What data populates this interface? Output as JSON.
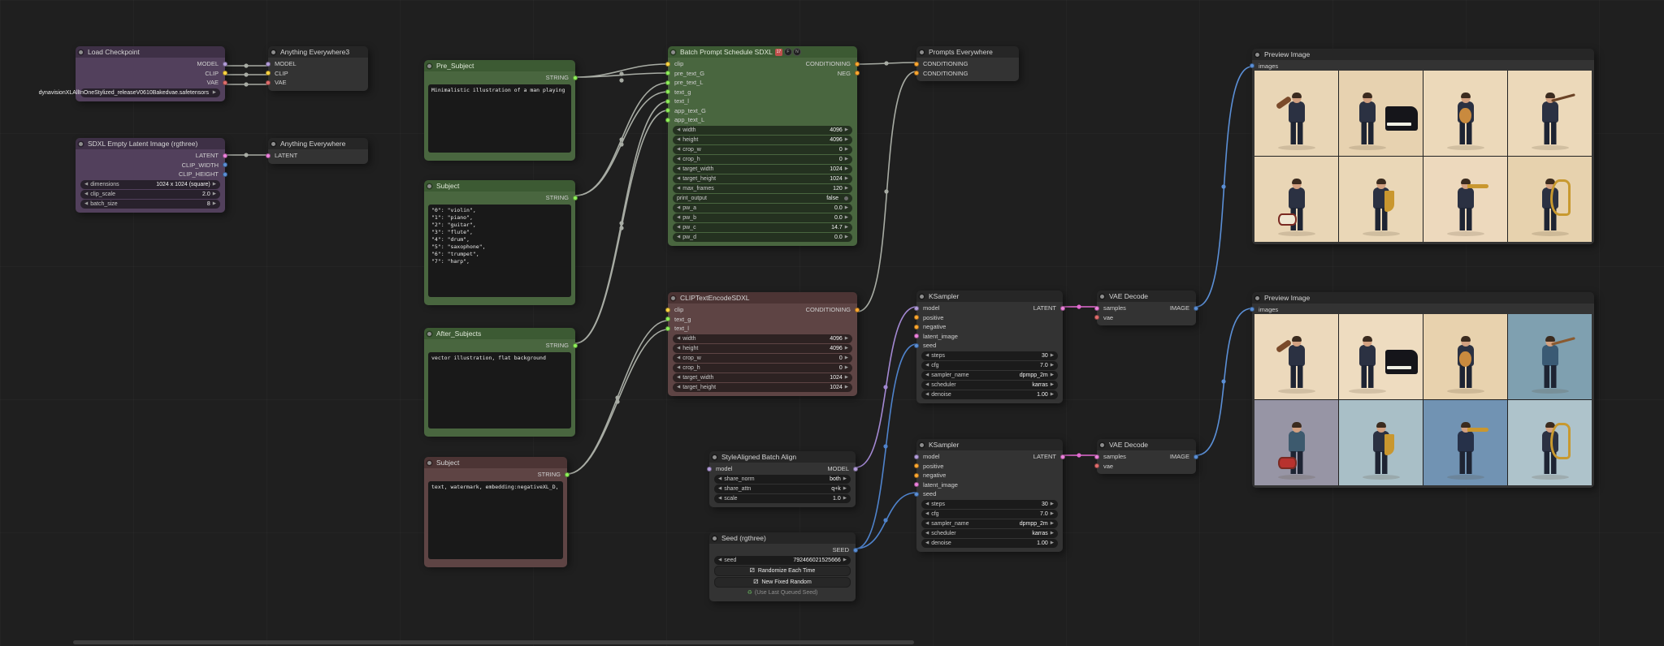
{
  "colors": {
    "model": "#b39ddb",
    "clip": "#ffd642",
    "vae": "#e06d6d",
    "latent": "#ee82dd",
    "conditioning": "#ffa931",
    "image": "#5b8fd6",
    "string": "#8ff05a",
    "int": "#5b8fd6",
    "seed": "#5b8fd6",
    "wire_gray": "#a8aca4",
    "wire_model": "#a489d4",
    "wire_latent": "#e26ad0",
    "wire_image": "#5b8fd6",
    "wire_seed": "#4f83cc"
  },
  "icons": {
    "dice": "⚂",
    "recycle": "♻"
  },
  "nodes": {
    "load_checkpoint": {
      "title": "Load Checkpoint",
      "outputs": [
        "MODEL",
        "CLIP",
        "VAE"
      ],
      "ckpt_name": "dynavisionXLAllInOneStylized_releaseV0610Bakedvae.safetensors"
    },
    "anything_everywhere3": {
      "title": "Anything Everywhere3",
      "inputs": [
        "MODEL",
        "CLIP",
        "VAE"
      ]
    },
    "sdxl_latent": {
      "title": "SDXL Empty Latent Image (rgthree)",
      "outputs": [
        "LATENT",
        "CLIP_WIDTH",
        "CLIP_HEIGHT"
      ],
      "widgets": [
        {
          "l": "dimensions",
          "v": "1024 x 1024  (square)"
        },
        {
          "l": "clip_scale",
          "v": "2.0"
        },
        {
          "l": "batch_size",
          "v": "8"
        }
      ]
    },
    "anything_everywhere": {
      "title": "Anything Everywhere",
      "inputs": [
        "LATENT"
      ]
    },
    "pre_subject": {
      "title": "Pre_Subject",
      "output": "STRING",
      "text": "Minimalistic illustration of a man playing"
    },
    "subject_list": {
      "title": "Subject",
      "output": "STRING",
      "text": "\"0\": \"violin\",\n\"1\": \"piano\",\n\"2\": \"guitar\",\n\"3\": \"flute\",\n\"4\": \"drum\",\n\"5\": \"saxophone\",\n\"6\": \"trumpet\",\n\"7\": \"harp\","
    },
    "after_subjects": {
      "title": "After_Subjects",
      "output": "STRING",
      "text": "vector illustration, flat background"
    },
    "subject_neg": {
      "title": "Subject",
      "output": "STRING",
      "text": "text, watermark, embedding:negativeXL_D,"
    },
    "batch_prompt": {
      "title": "Batch Prompt Schedule SDXL",
      "badges": [
        "17",
        "F",
        "N"
      ],
      "inputs": [
        "clip",
        "pre_text_G",
        "pre_text_L",
        "text_g",
        "text_l",
        "app_text_G",
        "app_text_L"
      ],
      "outputs": [
        "CONDITIONING",
        "NEG"
      ],
      "widgets": [
        {
          "l": "width",
          "v": "4096"
        },
        {
          "l": "height",
          "v": "4096"
        },
        {
          "l": "crop_w",
          "v": "0"
        },
        {
          "l": "crop_h",
          "v": "0"
        },
        {
          "l": "target_width",
          "v": "1024"
        },
        {
          "l": "target_height",
          "v": "1024"
        },
        {
          "l": "max_frames",
          "v": "120"
        },
        {
          "l": "print_output",
          "v": "false"
        },
        {
          "l": "pw_a",
          "v": "0.0"
        },
        {
          "l": "pw_b",
          "v": "0.0"
        },
        {
          "l": "pw_c",
          "v": "14.7"
        },
        {
          "l": "pw_d",
          "v": "0.0"
        }
      ]
    },
    "clip_encode": {
      "title": "CLIPTextEncodeSDXL",
      "inputs": [
        "clip",
        "text_g",
        "text_l"
      ],
      "output": "CONDITIONING",
      "widgets": [
        {
          "l": "width",
          "v": "4096"
        },
        {
          "l": "height",
          "v": "4096"
        },
        {
          "l": "crop_w",
          "v": "0"
        },
        {
          "l": "crop_h",
          "v": "0"
        },
        {
          "l": "target_width",
          "v": "1024"
        },
        {
          "l": "target_height",
          "v": "1024"
        }
      ]
    },
    "style_aligned": {
      "title": "StyleAligned Batch Align",
      "input": "model",
      "output": "MODEL",
      "widgets": [
        {
          "l": "share_norm",
          "v": "both"
        },
        {
          "l": "share_attn",
          "v": "q+k"
        },
        {
          "l": "scale",
          "v": "1.0"
        }
      ]
    },
    "seed_node": {
      "title": "Seed (rgthree)",
      "output": "SEED",
      "seed_widget": {
        "l": "seed",
        "v": "792466021525666"
      },
      "buttons": [
        "Randomize Each Time",
        "New Fixed Random",
        "(Use Last Queued Seed)"
      ]
    },
    "prompts_everywhere": {
      "title": "Prompts Everywhere",
      "inputs": [
        "CONDITIONING",
        "CONDITIONING"
      ]
    },
    "ksampler1": {
      "title": "KSampler",
      "inputs": [
        "model",
        "positive",
        "negative",
        "latent_image",
        "seed"
      ],
      "output": "LATENT",
      "widgets": [
        {
          "l": "steps",
          "v": "30"
        },
        {
          "l": "cfg",
          "v": "7.0"
        },
        {
          "l": "sampler_name",
          "v": "dpmpp_2m"
        },
        {
          "l": "scheduler",
          "v": "karras"
        },
        {
          "l": "denoise",
          "v": "1.00"
        }
      ]
    },
    "ksampler2": {
      "title": "KSampler",
      "inputs": [
        "model",
        "positive",
        "negative",
        "latent_image",
        "seed"
      ],
      "output": "LATENT",
      "widgets": [
        {
          "l": "steps",
          "v": "30"
        },
        {
          "l": "cfg",
          "v": "7.0"
        },
        {
          "l": "sampler_name",
          "v": "dpmpp_2m"
        },
        {
          "l": "scheduler",
          "v": "karras"
        },
        {
          "l": "denoise",
          "v": "1.00"
        }
      ]
    },
    "vae1": {
      "title": "VAE Decode",
      "inputs": [
        "samples",
        "vae"
      ],
      "output": "IMAGE"
    },
    "vae2": {
      "title": "VAE Decode",
      "inputs": [
        "samples",
        "vae"
      ],
      "output": "IMAGE"
    },
    "preview1": {
      "title": "Preview Image",
      "input": "images",
      "tiles": [
        {
          "instrument": "violin",
          "bg": "#e9d6b6",
          "accent": "#7a4a2a",
          "suit": "#2b3142"
        },
        {
          "instrument": "piano",
          "bg": "#e7d2b0",
          "accent": "#15151a",
          "suit": "#2b3142"
        },
        {
          "instrument": "guitar",
          "bg": "#ecd9ba",
          "accent": "#c98a3e",
          "suit": "#2b3142"
        },
        {
          "instrument": "flute",
          "bg": "#ecd9ba",
          "accent": "#6b4326",
          "suit": "#2b3142"
        },
        {
          "instrument": "drums",
          "bg": "#e9d6b6",
          "accent": "#efe6d2",
          "suit": "#2b3142"
        },
        {
          "instrument": "saxophone",
          "bg": "#ead7b7",
          "accent": "#c9972f",
          "suit": "#2b3142"
        },
        {
          "instrument": "trumpet",
          "bg": "#edd9bd",
          "accent": "#c9972f",
          "suit": "#2b3142"
        },
        {
          "instrument": "harp",
          "bg": "#e7d2ae",
          "accent": "#c8992f",
          "suit": "#2b3142"
        }
      ]
    },
    "preview2": {
      "title": "Preview Image",
      "input": "images",
      "tiles": [
        {
          "instrument": "violin",
          "bg": "#ecd9bc",
          "accent": "#7a4a2a",
          "suit": "#2b3142"
        },
        {
          "instrument": "piano",
          "bg": "#eedcc0",
          "accent": "#15151a",
          "suit": "#2b3142"
        },
        {
          "instrument": "guitar",
          "bg": "#e8d2ae",
          "accent": "#c98a3e",
          "suit": "#2b3142"
        },
        {
          "instrument": "flute",
          "bg": "#7fa0b0",
          "accent": "#8a5a30",
          "suit": "#3a5a74"
        },
        {
          "instrument": "drums",
          "bg": "#9795a5",
          "accent": "#b8322e",
          "suit": "#3d5a6e"
        },
        {
          "instrument": "saxophone",
          "bg": "#a9bfc7",
          "accent": "#c9972f",
          "suit": "#2b3142"
        },
        {
          "instrument": "trumpet",
          "bg": "#7193b3",
          "accent": "#c9972f",
          "suit": "#263149"
        },
        {
          "instrument": "harp",
          "bg": "#aec3cb",
          "accent": "#c8992f",
          "suit": "#2b3142"
        }
      ]
    }
  }
}
